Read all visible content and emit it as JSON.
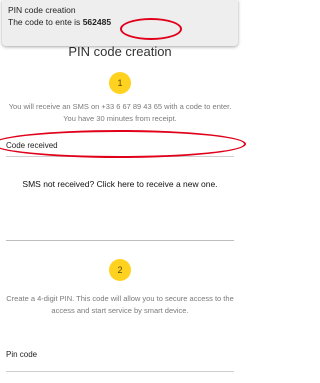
{
  "notification": {
    "title": "PIN code creation",
    "body_prefix": "The code to ente",
    "body_middle": "is",
    "code": "562485"
  },
  "page": {
    "title": "PIN code creation"
  },
  "step1": {
    "number": "1",
    "text": "You will receive an SMS on +33 6 67 89 43 65 with a code to enter. You have 30 minutes from receipt."
  },
  "code_field": {
    "label": "Code received"
  },
  "resend": {
    "label": "SMS not received? Click here to receive a new one."
  },
  "step2": {
    "number": "2",
    "text": "Create a 4-digit PIN. This code will allow you to secure access to the access and start service by smart device."
  },
  "pin_field": {
    "label": "Pin code"
  },
  "colors": {
    "badge": "#ffd21f",
    "annotation": "#e0001a"
  }
}
